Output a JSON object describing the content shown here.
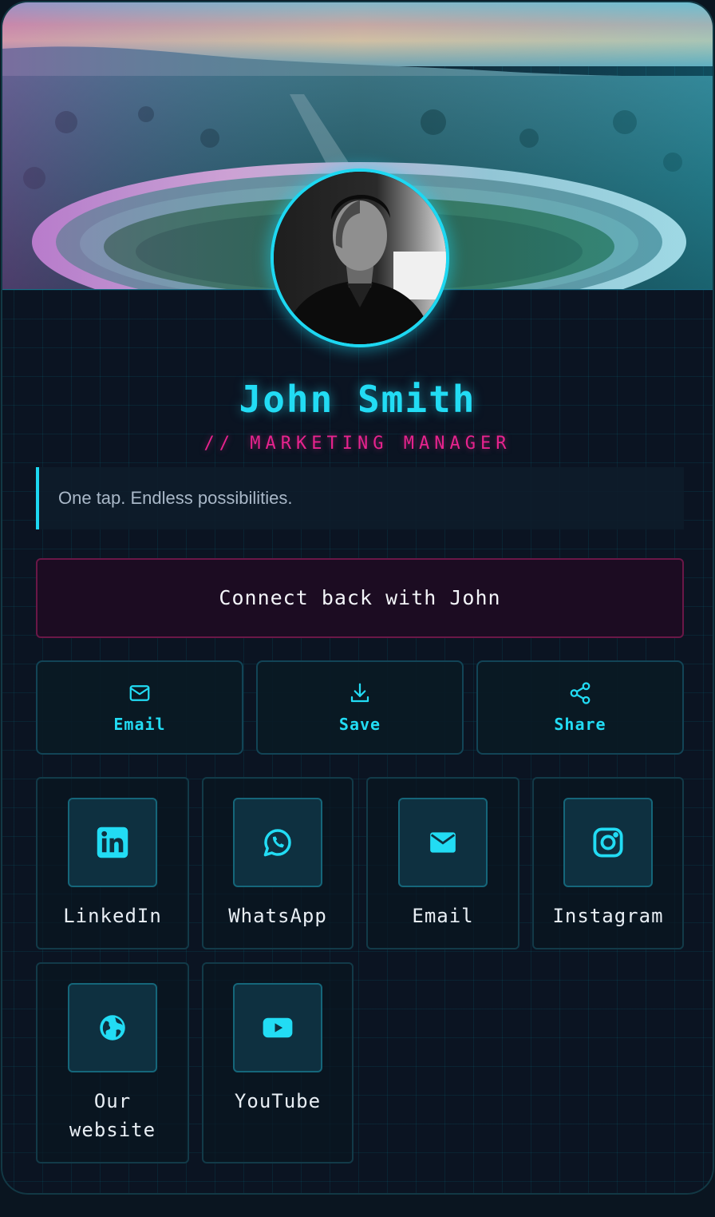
{
  "profile": {
    "name": "John Smith",
    "title": "// MARKETING MANAGER",
    "tagline": "One tap. Endless possibilities."
  },
  "connect_label": "Connect back with John",
  "actions": [
    {
      "label": "Email",
      "icon": "mail-outline-icon"
    },
    {
      "label": "Save",
      "icon": "download-icon"
    },
    {
      "label": "Share",
      "icon": "share-icon"
    }
  ],
  "socials": [
    {
      "label": "LinkedIn",
      "icon": "linkedin-icon"
    },
    {
      "label": "WhatsApp",
      "icon": "whatsapp-icon"
    },
    {
      "label": "Email",
      "icon": "mail-icon"
    },
    {
      "label": "Instagram",
      "icon": "instagram-icon"
    },
    {
      "label": "Our website",
      "icon": "globe-icon"
    },
    {
      "label": "YouTube",
      "icon": "youtube-icon"
    }
  ],
  "colors": {
    "accent_cyan": "#22dcf4",
    "accent_pink": "#e8238e",
    "background": "#0b1422"
  }
}
